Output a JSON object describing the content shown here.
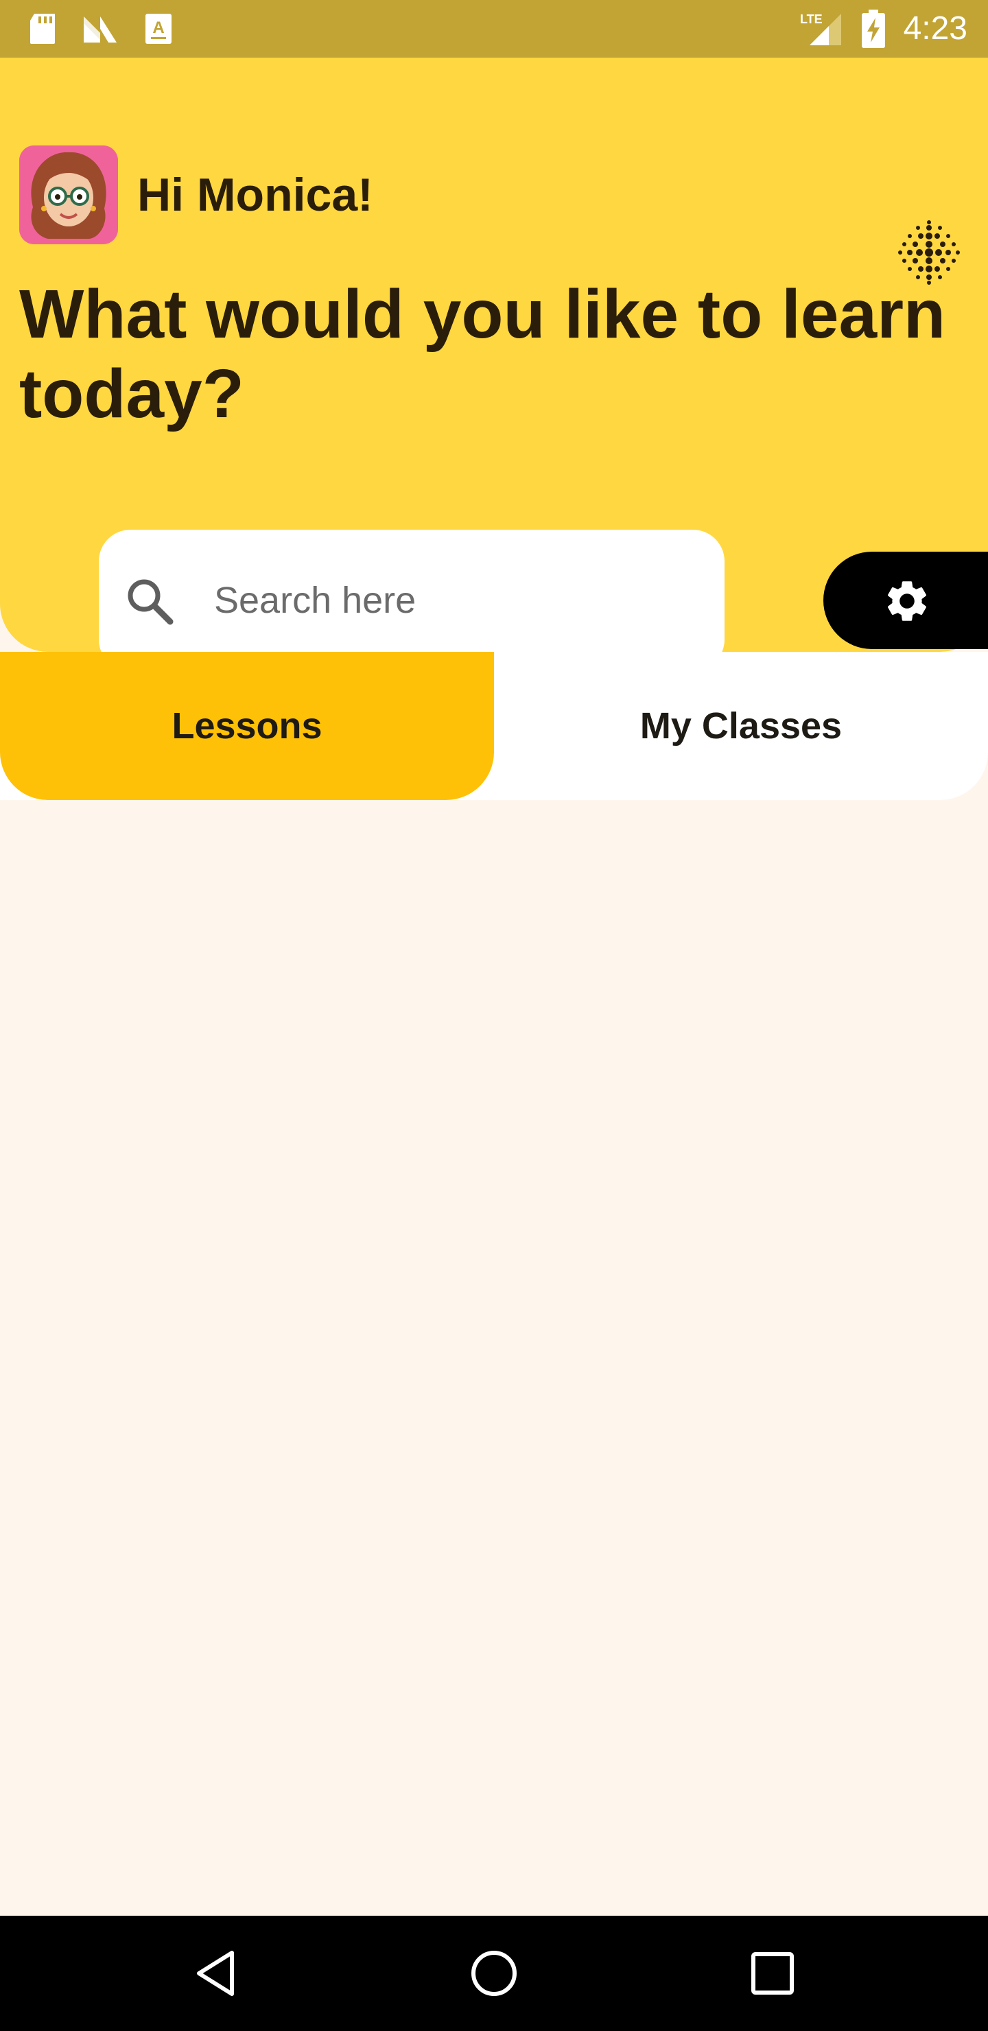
{
  "status_bar": {
    "time": "4:23",
    "left_icons": [
      "sd-card-icon",
      "notification-n-icon",
      "text-a-icon"
    ],
    "right_icons": [
      "lte-signal-icon",
      "battery-charging-icon"
    ],
    "network_label": "LTE"
  },
  "header": {
    "greeting": "Hi Monica!",
    "headline": "What would you like to learn today?",
    "avatar_icon": "avatar-monica",
    "menu_icon": "dot-grid-icon"
  },
  "search": {
    "placeholder": "Search here",
    "value": ""
  },
  "settings": {
    "icon": "gear-icon"
  },
  "tabs": [
    {
      "label": "Lessons",
      "active": true
    },
    {
      "label": "My Classes",
      "active": false
    }
  ],
  "nav_bar": {
    "buttons": [
      "back-icon",
      "home-icon",
      "recents-icon"
    ]
  },
  "colors": {
    "status_bar": "#C2A434",
    "header": "#FFD740",
    "active_tab": "#FFC107",
    "page_background": "#FEF6EC",
    "settings_button": "#000000",
    "avatar_background": "#F0639A"
  }
}
